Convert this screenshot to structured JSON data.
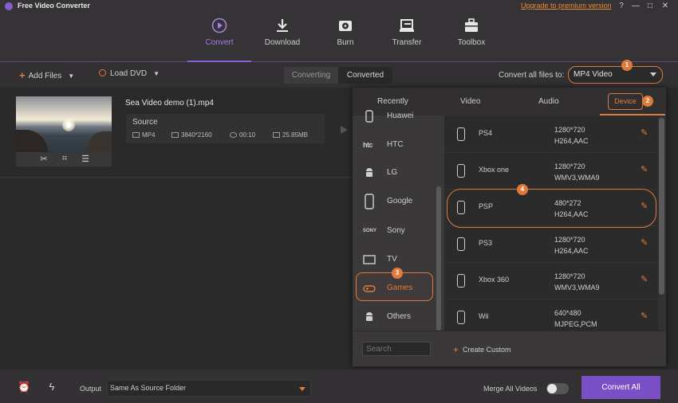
{
  "window": {
    "title": "Free Video Converter",
    "upgrade_link": "Upgrade to premium version",
    "controls": [
      "?",
      "—",
      "□",
      "✕"
    ]
  },
  "nav": {
    "items": [
      {
        "label": "Convert",
        "icon": "convert-icon",
        "active": true
      },
      {
        "label": "Download",
        "icon": "download-icon"
      },
      {
        "label": "Burn",
        "icon": "burn-icon"
      },
      {
        "label": "Transfer",
        "icon": "transfer-icon"
      },
      {
        "label": "Toolbox",
        "icon": "toolbox-icon"
      }
    ]
  },
  "toolbar": {
    "add_files": "Add Files",
    "load_dvd": "Load DVD",
    "tab_converting": "Converting",
    "tab_converted": "Converted",
    "convert_all_label": "Convert all files to:",
    "format_value": "MP4 Video",
    "badge_1": "1"
  },
  "file": {
    "name": "Sea Video demo (1).mp4",
    "source_label": "Source",
    "format": "MP4",
    "resolution": "3840*2160",
    "duration": "00:10",
    "size": "25.85MB"
  },
  "panel": {
    "tabs": [
      "Recently",
      "Video",
      "Audio",
      "Device"
    ],
    "badge_2": "2",
    "badge_3": "3",
    "badge_4": "4",
    "categories": [
      {
        "label": "Huawei",
        "icon": "huawei-icon"
      },
      {
        "label": "HTC",
        "icon": "htc-logo-icon",
        "logo": "htc"
      },
      {
        "label": "LG",
        "icon": "android-icon"
      },
      {
        "label": "Google",
        "icon": "phone-icon"
      },
      {
        "label": "Sony",
        "icon": "sony-logo-icon",
        "logo": "SONY"
      },
      {
        "label": "TV",
        "icon": "tv-icon"
      },
      {
        "label": "Games",
        "icon": "gamepad-icon",
        "selected": true
      },
      {
        "label": "Others",
        "icon": "android-icon"
      }
    ],
    "devices": [
      {
        "name": "PS4",
        "res": "1280*720",
        "codec": "H264,AAC"
      },
      {
        "name": "Xbox one",
        "res": "1280*720",
        "codec": "WMV3,WMA9"
      },
      {
        "name": "PSP",
        "res": "480*272",
        "codec": "H264,AAC",
        "selected": true
      },
      {
        "name": "PS3",
        "res": "1280*720",
        "codec": "H264,AAC"
      },
      {
        "name": "Xbox 360",
        "res": "1280*720",
        "codec": "WMV3,WMA9"
      },
      {
        "name": "Wii",
        "res": "640*480",
        "codec": "MJPEG,PCM"
      }
    ],
    "search_placeholder": "Search",
    "create_custom": "Create Custom"
  },
  "bottom": {
    "output_label": "Output",
    "output_value": "Same As Source Folder",
    "merge_label": "Merge All Videos",
    "merge_on": false,
    "convert_all": "Convert All"
  }
}
